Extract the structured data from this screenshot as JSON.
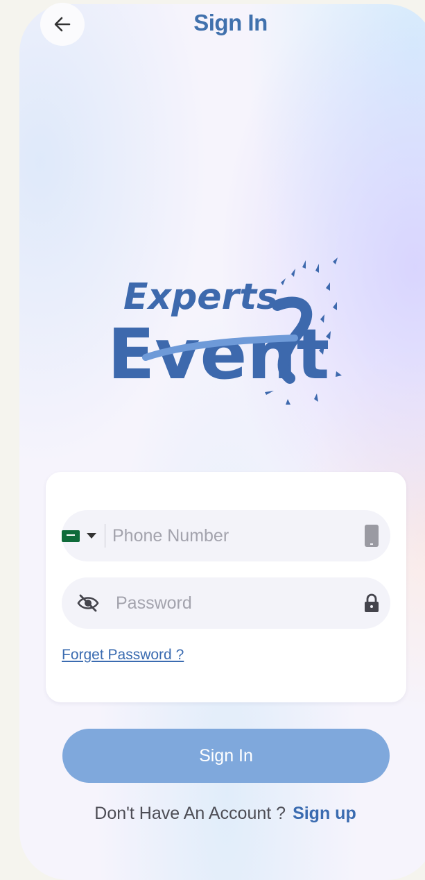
{
  "header": {
    "title": "Sign In",
    "back_icon": "arrow-left-icon"
  },
  "logo": {
    "line1": "Experts",
    "line2": "Event"
  },
  "form": {
    "country_flag": "saudi-flag-icon",
    "phone_placeholder": "Phone Number",
    "phone_icon": "phone-icon",
    "password_placeholder": "Password",
    "password_toggle_icon": "eye-off-icon",
    "password_icon": "lock-icon",
    "forget_label": "Forget Password ?"
  },
  "actions": {
    "signin_label": "Sign In",
    "no_account_text": "Don't Have An Account ?",
    "signup_label": "Sign up"
  },
  "colors": {
    "brand": "#3d69ad",
    "primary_button": "#7fa8dc",
    "link": "#3a6bb0"
  }
}
